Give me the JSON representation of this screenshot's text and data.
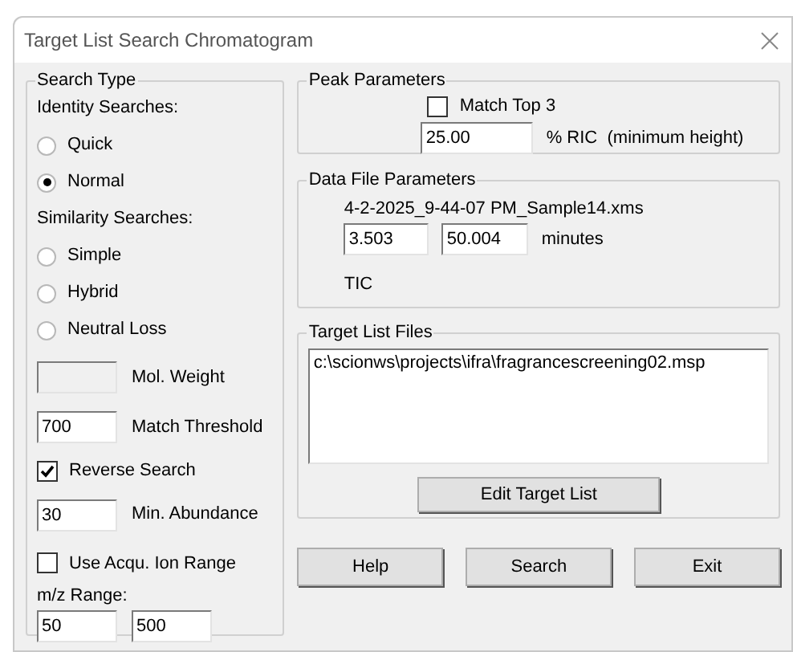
{
  "window": {
    "title": "Target List Search Chromatogram"
  },
  "search_type": {
    "title": "Search Type",
    "identity_label": "Identity Searches:",
    "identity_options": [
      {
        "label": "Quick",
        "selected": false
      },
      {
        "label": "Normal",
        "selected": true
      }
    ],
    "similarity_label": "Similarity Searches:",
    "similarity_options": [
      {
        "label": "Simple",
        "selected": false
      },
      {
        "label": "Hybrid",
        "selected": false
      },
      {
        "label": "Neutral Loss",
        "selected": false
      }
    ],
    "mol_weight": {
      "label": "Mol. Weight",
      "disabled": true
    },
    "match_threshold": {
      "value": "700",
      "label": "Match Threshold"
    },
    "reverse_search": {
      "label": "Reverse Search",
      "checked": true
    },
    "min_abundance": {
      "value": "30",
      "label": "Min. Abundance"
    },
    "use_acqu_ion_range": {
      "label": "Use Acqu. Ion Range",
      "checked": false
    },
    "mz_range": {
      "label": "m/z Range:",
      "from": "50",
      "to": "500"
    }
  },
  "peak_parameters": {
    "title": "Peak Parameters",
    "match_top3": {
      "label": "Match Top 3",
      "checked": false
    },
    "ric": {
      "value": "25.00",
      "label": "% RIC  (minimum height)"
    }
  },
  "data_file_parameters": {
    "title": "Data File Parameters",
    "file_name": "4-2-2025_9-44-07 PM_Sample14.xms",
    "start": "3.503",
    "end": "50.004",
    "unit": "minutes",
    "trace": "TIC"
  },
  "target_list_files": {
    "title": "Target List Files",
    "files": [
      "c:\\scionws\\projects\\ifra\\fragrancescreening02.msp"
    ],
    "edit_button": "Edit Target List"
  },
  "buttons": [
    "Help",
    "Search",
    "Exit"
  ]
}
